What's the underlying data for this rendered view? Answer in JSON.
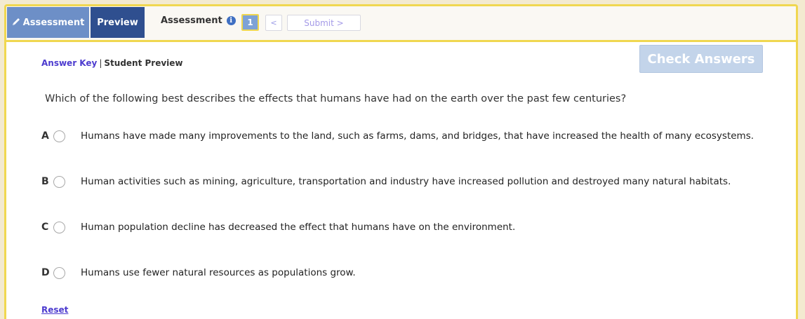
{
  "tabs": {
    "assessment": "Assessment",
    "preview": "Preview"
  },
  "header": {
    "title": "Assessment",
    "info_icon": "info-icon",
    "page_number": "1",
    "prev": "<",
    "submit": "Submit >"
  },
  "preview_nav": {
    "answer_key": "Answer Key",
    "separator": "|",
    "student_preview": "Student Preview"
  },
  "check_answers": "Check Answers",
  "question": "Which of the following best describes the effects that humans have had on the earth over the past few centuries?",
  "choices": [
    {
      "letter": "A",
      "text": "Humans have made many improvements to the land, such as farms, dams, and bridges, that have increased the health of many ecosystems."
    },
    {
      "letter": "B",
      "text": "Human activities such as mining, agriculture, transportation and industry have increased pollution and destroyed many natural habitats."
    },
    {
      "letter": "C",
      "text": "Human population decline has decreased the effect that humans have on the environment."
    },
    {
      "letter": "D",
      "text": "Humans use fewer natural resources as populations grow."
    }
  ],
  "reset": "Reset",
  "colors": {
    "accent_border": "#f0d750",
    "tab_active": "#6d8fc7",
    "tab_preview": "#2f4f8f",
    "link": "#4d3ccf"
  }
}
